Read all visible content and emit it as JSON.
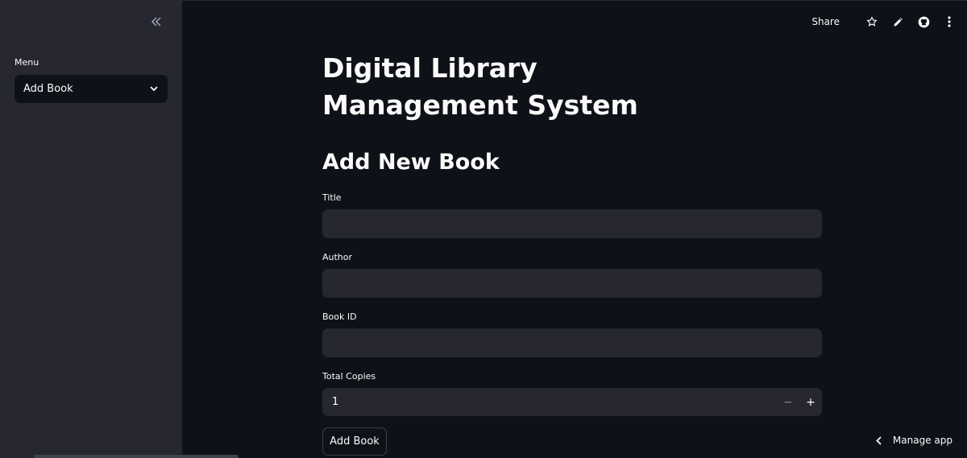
{
  "sidebar": {
    "label": "Menu",
    "select_value": "Add Book"
  },
  "toolbar": {
    "share_label": "Share",
    "icons": [
      "star-icon",
      "pencil-icon",
      "github-icon",
      "kebab-menu-icon"
    ]
  },
  "main": {
    "page_title": "Digital Library Management System",
    "section_title": "Add New Book",
    "fields": {
      "title_label": "Title",
      "author_label": "Author",
      "book_id_label": "Book ID",
      "total_copies_label": "Total Copies",
      "total_copies_value": "1"
    },
    "stepper": {
      "minus": "−",
      "plus": "+"
    },
    "submit_label": "Add Book"
  },
  "footer": {
    "manage_app_label": "Manage app"
  },
  "colors": {
    "background": "#0e1117",
    "sidebar": "#262730",
    "input": "#262730",
    "text": "#fafafa"
  }
}
